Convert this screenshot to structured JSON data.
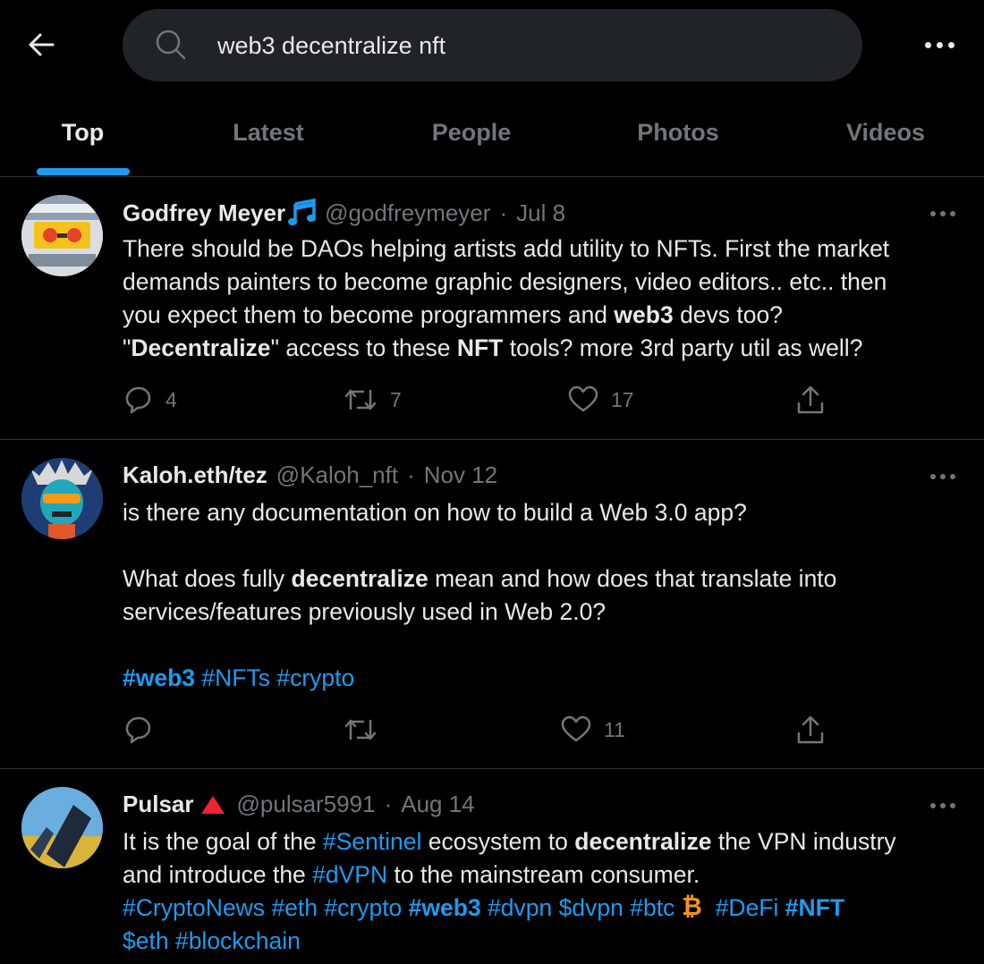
{
  "search": {
    "query": "web3 decentralize nft"
  },
  "tabs": [
    {
      "label": "Top",
      "active": true
    },
    {
      "label": "Latest",
      "active": false
    },
    {
      "label": "People",
      "active": false
    },
    {
      "label": "Photos",
      "active": false
    },
    {
      "label": "Videos",
      "active": false
    }
  ],
  "colors": {
    "accent": "#1d9bf0",
    "background": "#000000",
    "secondary_text": "#71767b",
    "divider": "#2f3336",
    "bitcoin": "#f7931a",
    "red_triangle": "#f4212e"
  },
  "tweets": [
    {
      "name": "Godfrey Meyer",
      "name_emoji": "musical-note-icon",
      "handle": "@godfreymeyer",
      "sep": "·",
      "date": "Jul 8",
      "body": {
        "l1": "There should be DAOs helping artists add utility to NFTs. First the market",
        "l2": "demands painters to become graphic designers, video editors.. etc.. then",
        "l3a": "you expect them to become programmers and ",
        "l3b": "web3",
        "l3c": " devs too?",
        "l4a": "\"",
        "l4b": "Decentralize",
        "l4c": "\" access to these ",
        "l4d": "NFT",
        "l4e": " tools? more 3rd party util as well?"
      },
      "replies": "4",
      "retweets": "7",
      "likes": "17"
    },
    {
      "name": "Kaloh.eth/tez",
      "handle": "@Kaloh_nft",
      "sep": "·",
      "date": "Nov 12",
      "body": {
        "l1": "is there any documentation on how to build a Web 3.0 app?",
        "l2a": "What does fully ",
        "l2b": "decentralize",
        "l2c": " mean and how does that translate into",
        "l3": "services/features previously used in Web 2.0?",
        "tag1": "#web3",
        "tag2": "#NFTs",
        "tag3": "#crypto"
      },
      "replies": "",
      "retweets": "",
      "likes": "11"
    },
    {
      "name": "Pulsar",
      "name_emoji": "red-triangle-icon",
      "handle": "@pulsar5991",
      "sep": "·",
      "date": "Aug 14",
      "body": {
        "l1a": "It is the goal of the ",
        "l1b": "#Sentinel",
        "l1c": " ecosystem to ",
        "l1d": "decentralize",
        "l1e": " the VPN industry",
        "l2a": "and introduce the ",
        "l2b": "#dVPN",
        "l2c": " to the mainstream consumer.",
        "t1": "#CryptoNews",
        "t2": "#eth",
        "t3": "#crypto",
        "t4": "#web3",
        "t5": "#dvpn",
        "t6": "$dvpn",
        "t7": "#btc",
        "t8": "#DeFi",
        "t9": "#NFT",
        "t10": "$eth",
        "t11": "#blockchain"
      }
    }
  ]
}
